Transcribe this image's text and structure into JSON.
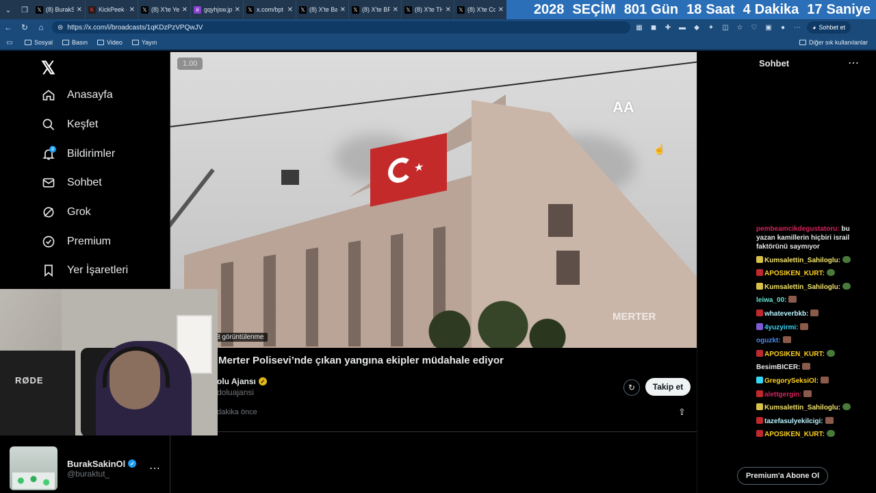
{
  "browser": {
    "tabs": [
      {
        "icon": "x-icon",
        "title": "(8) BurakSa"
      },
      {
        "icon": "kick-icon",
        "title": "KickPeek -"
      },
      {
        "icon": "x-icon",
        "title": "(8) X'te Ye"
      },
      {
        "icon": "image-icon",
        "title": "gqyhjsw.jp"
      },
      {
        "icon": "x-icon",
        "title": "x.com/bpt"
      },
      {
        "icon": "x-icon",
        "title": "(8) X'te Ba"
      },
      {
        "icon": "x-icon",
        "title": "(8) X'te BP"
      },
      {
        "icon": "x-icon",
        "title": "(8) X'te TH"
      },
      {
        "icon": "x-icon",
        "title": "(8) X'te Co"
      }
    ],
    "countdown": {
      "year": "2028",
      "label": "SEÇİM",
      "days_value": "801",
      "days_label": "Gün",
      "hours_value": "18",
      "hours_label": "Saat",
      "minutes_value": "4",
      "minutes_label": "Dakika",
      "seconds_value": "17",
      "seconds_label": "Saniye"
    },
    "url": "https://x.com/i/broadcasts/1qKDzPzVPQwJV",
    "copilot_label": "Sohbet et",
    "bookmarks": [
      "Sosyal",
      "Basın",
      "Video",
      "Yayın"
    ],
    "bookmarks_other": "Diğer sık kullanılanlar"
  },
  "nav": {
    "items": [
      {
        "label": "Anasayfa",
        "icon": "home-icon"
      },
      {
        "label": "Keşfet",
        "icon": "search-icon"
      },
      {
        "label": "Bildirimler",
        "icon": "bell-icon",
        "badge": "8"
      },
      {
        "label": "Sohbet",
        "icon": "mail-icon"
      },
      {
        "label": "Grok",
        "icon": "grok-icon"
      },
      {
        "label": "Premium",
        "icon": "premium-icon"
      },
      {
        "label": "Yer İşaretleri",
        "icon": "bookmark-icon"
      }
    ]
  },
  "profile": {
    "name": "BurakSakinOl",
    "handle": "@buraktut_"
  },
  "webcam": {
    "mic_brand": "RØDE"
  },
  "broadcast": {
    "speed": "1.00",
    "views": "8 görüntülenme",
    "title": "Merter Polisevi’nde çıkan yangına ekipler müdahale ediyor",
    "owner": "olu Ajansı",
    "owner_handle": "doluajansi",
    "time": "dakika önce",
    "follow_label": "Takip et",
    "watermark_logo": "AA",
    "watermark_text": "MERTER"
  },
  "chat": {
    "title": "Sohbet",
    "messages": [
      {
        "user": "pembeamcikdegustatoru:",
        "color": "#d4245c",
        "text": "bu yazan kamillerin hiçbiri israil faktörünü saymıyor",
        "emote": ""
      },
      {
        "user": "Kumsalettin_Sahiloglu:",
        "color": "#f2e36b",
        "text": "",
        "emote": "pepe",
        "badge": "#d8c24a"
      },
      {
        "user": "APOSIKEN_KURT:",
        "color": "#ffd21f",
        "text": "",
        "emote": "pepe",
        "badge": "#c0282d"
      },
      {
        "user": "Kumsalettin_Sahiloglu:",
        "color": "#f2e36b",
        "text": "",
        "emote": "pepe",
        "badge": "#d8c24a"
      },
      {
        "user": "leiwa_00:",
        "color": "#67e0d0",
        "text": "",
        "emote": "face",
        "badge": ""
      },
      {
        "user": "whateverbkb:",
        "color": "#b9f4ff",
        "text": "",
        "emote": "face",
        "badge": "#c0282d"
      },
      {
        "user": "4yuzyirmi:",
        "color": "#38d6f5",
        "text": "",
        "emote": "face",
        "badge": "#7e5bd6"
      },
      {
        "user": "oguzkt:",
        "color": "#4b8cf0",
        "text": "",
        "emote": "face",
        "badge": ""
      },
      {
        "user": "APOSIKEN_KURT:",
        "color": "#ffd21f",
        "text": "",
        "emote": "pepe",
        "badge": "#c0282d"
      },
      {
        "user": "BesimBICER:",
        "color": "#e7e9ea",
        "text": "",
        "emote": "face",
        "badge": ""
      },
      {
        "user": "GregorySeksiOl:",
        "color": "#ffd21f",
        "text": "",
        "emote": "face",
        "badge": "#38d6f5"
      },
      {
        "user": "alettgergin:",
        "color": "#d4245c",
        "text": "",
        "emote": "face",
        "badge": "#c0282d"
      },
      {
        "user": "Kumsalettin_Sahiloglu:",
        "color": "#f2e36b",
        "text": "",
        "emote": "pepe",
        "badge": "#d8c24a"
      },
      {
        "user": "tazefasulyekilcigi:",
        "color": "#b9f4ff",
        "text": "",
        "emote": "face",
        "badge": "#c0282d"
      },
      {
        "user": "APOSIKEN_KURT:",
        "color": "#ffd21f",
        "text": "",
        "emote": "pepe",
        "badge": "#c0282d"
      }
    ],
    "premium_label": "Premium'a Abone Ol"
  }
}
